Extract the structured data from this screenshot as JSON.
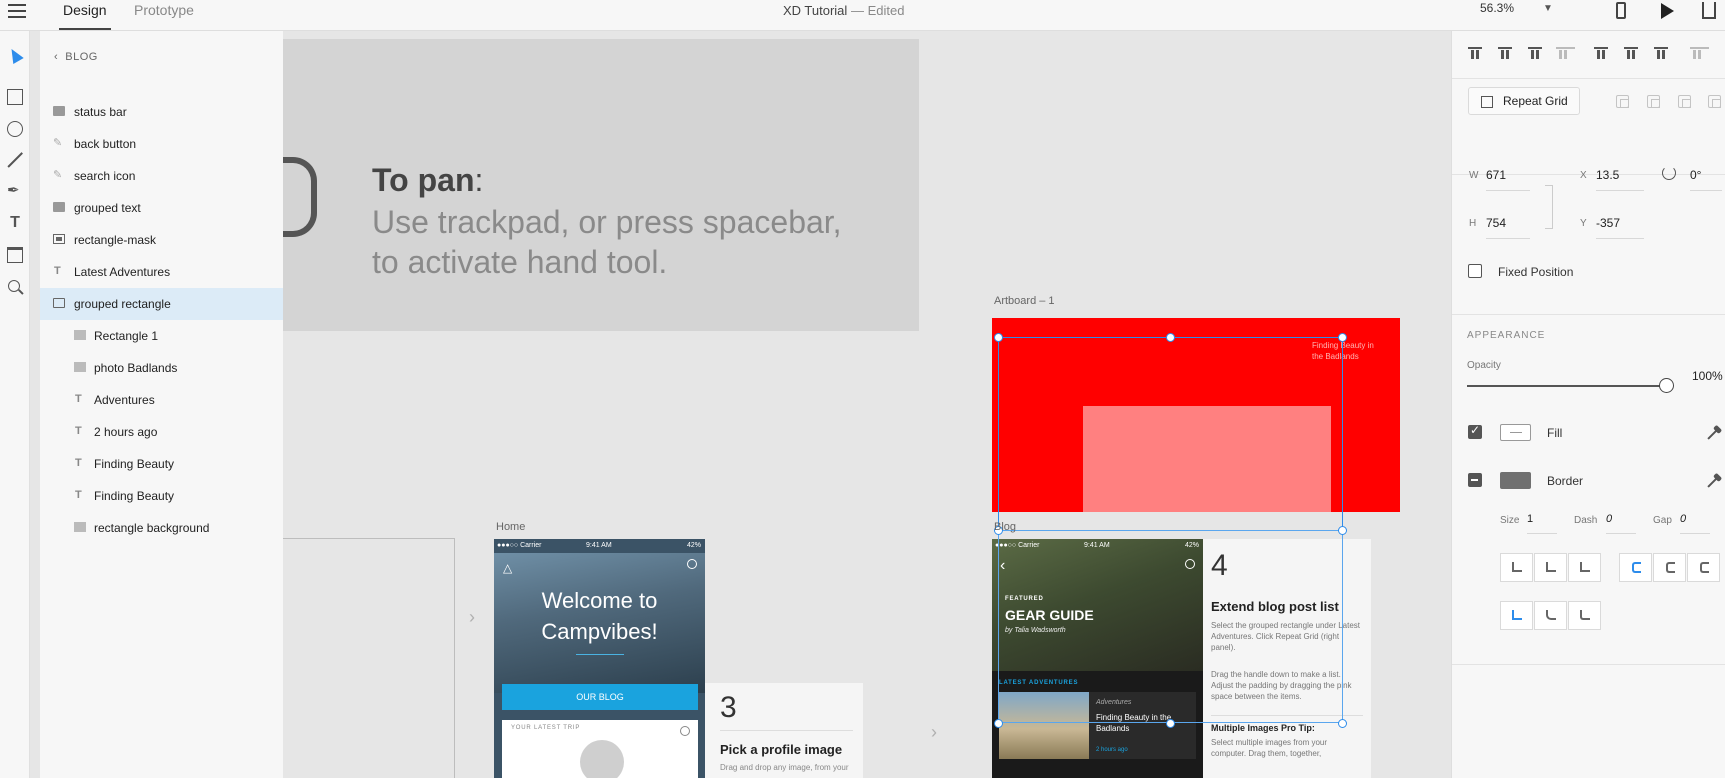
{
  "app": {
    "tabs": [
      {
        "label": "Design",
        "active": true
      },
      {
        "label": "Prototype",
        "active": false
      }
    ],
    "doc_title": "XD Tutorial",
    "doc_sep": "—",
    "doc_status": "Edited",
    "zoom": "56.3%"
  },
  "tools": [
    "select-tool",
    "rectangle-tool",
    "ellipse-tool",
    "line-tool",
    "pen-tool",
    "text-tool",
    "artboard-tool",
    "zoom-tool"
  ],
  "layers": {
    "back_label": "BLOG",
    "items": [
      {
        "label": "status bar",
        "icon": "folder-icon"
      },
      {
        "label": "back button",
        "icon": "path-icon"
      },
      {
        "label": "search icon",
        "icon": "path-icon"
      },
      {
        "label": "grouped text",
        "icon": "folder-icon"
      },
      {
        "label": "rectangle-mask",
        "icon": "mask-icon"
      },
      {
        "label": "Latest Adventures",
        "icon": "text-icon"
      },
      {
        "label": "grouped rectangle",
        "icon": "folder-outline-icon",
        "selected": true
      },
      {
        "label": "Rectangle 1",
        "icon": "rectangle-icon"
      },
      {
        "label": "photo Badlands",
        "icon": "rectangle-icon"
      },
      {
        "label": "Adventures",
        "icon": "text-icon"
      },
      {
        "label": "2 hours ago",
        "icon": "text-icon"
      },
      {
        "label": "Finding Beauty",
        "icon": "text-icon"
      },
      {
        "label": "Finding Beauty",
        "icon": "text-icon"
      },
      {
        "label": "rectangle background",
        "icon": "rectangle-icon"
      }
    ]
  },
  "canvas": {
    "hint": {
      "title": "To pan",
      "title_colon": ":",
      "line1": "Use trackpad, or press spacebar,",
      "line2": "to activate hand tool."
    },
    "artboard1_label": "Artboard – 1",
    "artboard1_text": "Finding Beauty in the Badlands",
    "home_label": "Home",
    "blog_label": "Blog",
    "home": {
      "carrier": "●●●○○ Carrier ",
      "time": "9:41 AM",
      "battery": "42%",
      "welcome_line1": "Welcome to",
      "welcome_line2": "Campvibes!",
      "blog_button": "OUR BLOG",
      "card_title": "YOUR LATEST TRIP"
    },
    "step3": {
      "number": "3",
      "title": "Pick a profile image",
      "sub": "Drag and drop any image, from your"
    },
    "blog": {
      "carrier": "●●●○○ Carrier ",
      "time": "9:41 AM",
      "battery": "42%",
      "featured": "FEATURED",
      "headline": "GEAR GUIDE",
      "byline": "by Talia Wadsworth",
      "latest": "LATEST ADVENTURES",
      "row_category": "Adventures",
      "row_title": "Finding Beauty in the Badlands",
      "row_time": "2 hours ago"
    },
    "step4": {
      "number": "4",
      "title": "Extend blog post list",
      "body": "Select the grouped rectangle under Latest Adventures. Click Repeat Grid  (right panel).",
      "body2": "Drag the handle down to make a list. Adjust the padding by dragging the pink space between the items.",
      "tip_title": "Multiple Images Pro Tip:",
      "tip_body": "Select multiple images from your computer. Drag them, together,"
    }
  },
  "props": {
    "repeat_grid": "Repeat Grid",
    "w_label": "W",
    "w": "671",
    "h_label": "H",
    "h": "754",
    "x_label": "X",
    "x": "13.5",
    "y_label": "Y",
    "y": "-357",
    "rotation": "0°",
    "fixed_position": "Fixed Position",
    "appearance": "APPEARANCE",
    "opacity_label": "Opacity",
    "opacity": "100%",
    "opacity_value": 1.0,
    "fill_label": "Fill",
    "border_label": "Border",
    "size_label": "Size",
    "size": "1",
    "dash_label": "Dash",
    "dash": "0",
    "gap_label": "Gap",
    "gap": "0"
  },
  "colors": {
    "accent": "#2d8ceb",
    "artboard1_fill": "#ff0000",
    "artboard1_pink": "#ff8080",
    "blog_blue": "#1aa3de"
  }
}
